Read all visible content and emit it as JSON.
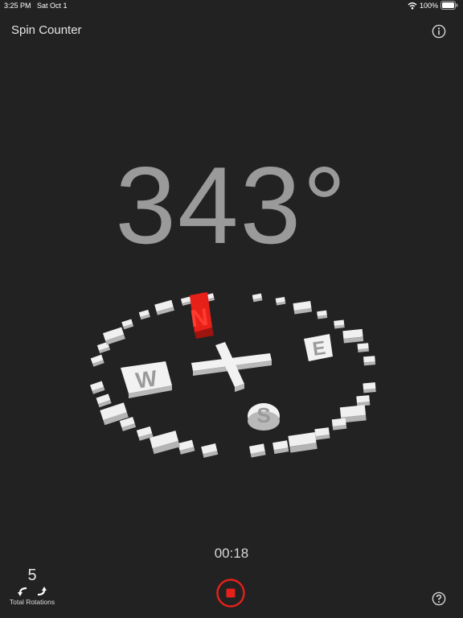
{
  "status_bar": {
    "time": "3:25 PM",
    "date": "Sat Oct 1",
    "battery": "100%",
    "icons": [
      "wifi-icon",
      "battery-icon"
    ]
  },
  "header": {
    "title": "Spin Counter",
    "info_icon": "info-icon"
  },
  "heading": {
    "value": "343°"
  },
  "compass": {
    "north": "N",
    "east": "E",
    "south": "S",
    "west": "W"
  },
  "timer": {
    "elapsed": "00:18"
  },
  "rotations": {
    "count": "5",
    "label": "Total Rotations",
    "icon": "rotate-arrows-icon"
  },
  "controls": {
    "stop_icon": "stop-icon",
    "help_icon": "help-icon"
  },
  "colors": {
    "background": "#222222",
    "heading_text": "#9a9a9a",
    "accent_red": "#e8201a",
    "compass_white": "#f0f0f0"
  }
}
